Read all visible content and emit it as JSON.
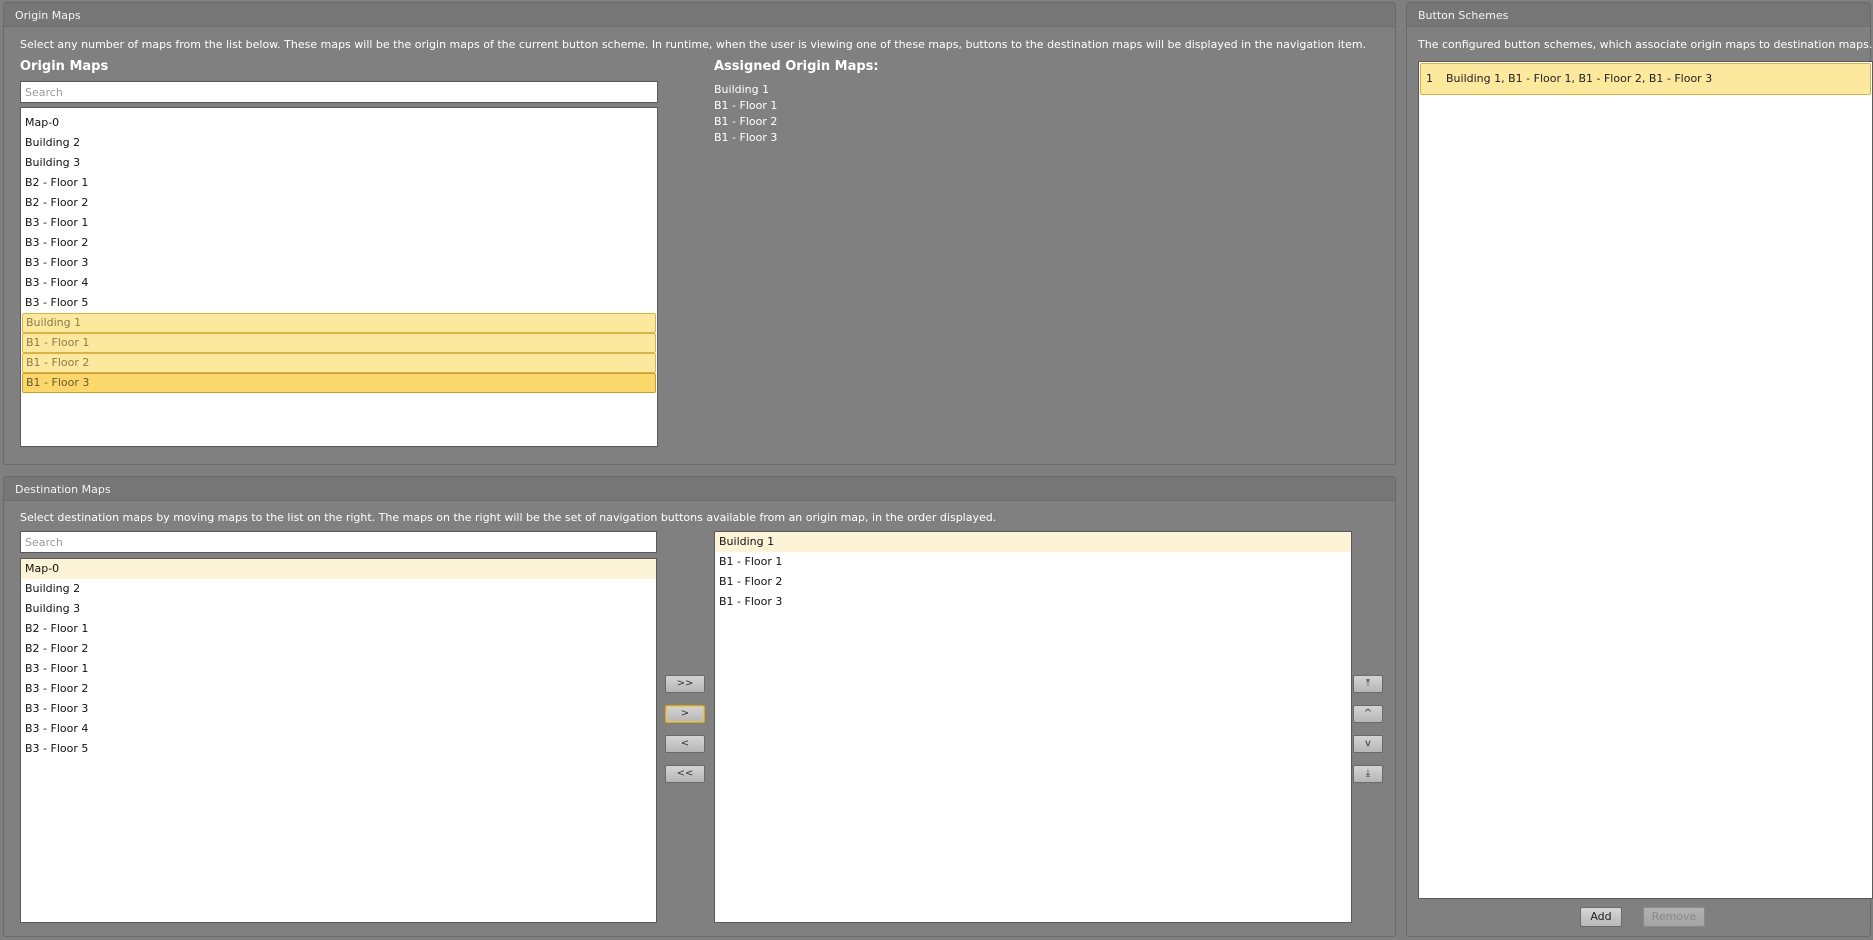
{
  "origin": {
    "group_title": "Origin Maps",
    "description": "Select any number of maps from the list below. These maps will be the origin maps of the current button scheme. In runtime, when the user is viewing one of these maps, buttons to the destination maps will be displayed in the navigation item.",
    "list_heading": "Origin Maps",
    "search_placeholder": "Search",
    "items": [
      "Map-0",
      "Building 2",
      "Building 3",
      "B2 - Floor 1",
      "B2 - Floor 2",
      "B3 - Floor 1",
      "B3 - Floor 2",
      "B3 - Floor 3",
      "B3 - Floor 4",
      "B3 - Floor 5",
      "Building 1",
      "B1 - Floor 1",
      "B1 - Floor 2",
      "B1 - Floor 3"
    ],
    "selected_items": [
      "Building 1",
      "B1 - Floor 1",
      "B1 - Floor 2",
      "B1 - Floor 3"
    ],
    "assigned_heading": "Assigned Origin Maps:",
    "assigned": [
      "Building 1",
      "B1 - Floor 1",
      "B1 - Floor 2",
      "B1 - Floor 3"
    ]
  },
  "destination": {
    "group_title": "Destination Maps",
    "description": "Select destination maps by moving maps to the list on the right. The maps on the right will be the set of navigation buttons available from an origin map, in the order displayed.",
    "search_placeholder": "Search",
    "available": [
      "Map-0",
      "Building 2",
      "Building 3",
      "B2 - Floor 1",
      "B2 - Floor 2",
      "B3 - Floor 1",
      "B3 - Floor 2",
      "B3 - Floor 3",
      "B3 - Floor 4",
      "B3 - Floor 5"
    ],
    "selected": [
      "Building 1",
      "B1 - Floor 1",
      "B1 - Floor 2",
      "B1 - Floor 3"
    ],
    "buttons": {
      "add_all": ">>",
      "add": ">",
      "remove": "<",
      "remove_all": "<<",
      "move_top": "⤒",
      "move_up": "^",
      "move_down": "v",
      "move_bottom": "⤓"
    }
  },
  "schemes": {
    "group_title": "Button Schemes",
    "description": "The configured button schemes, which associate origin maps to destination maps.",
    "rows": [
      {
        "number": "1",
        "text": "Building 1, B1 - Floor 1, B1 - Floor 2, B1 - Floor 3"
      }
    ],
    "add_label": "Add",
    "remove_label": "Remove"
  }
}
